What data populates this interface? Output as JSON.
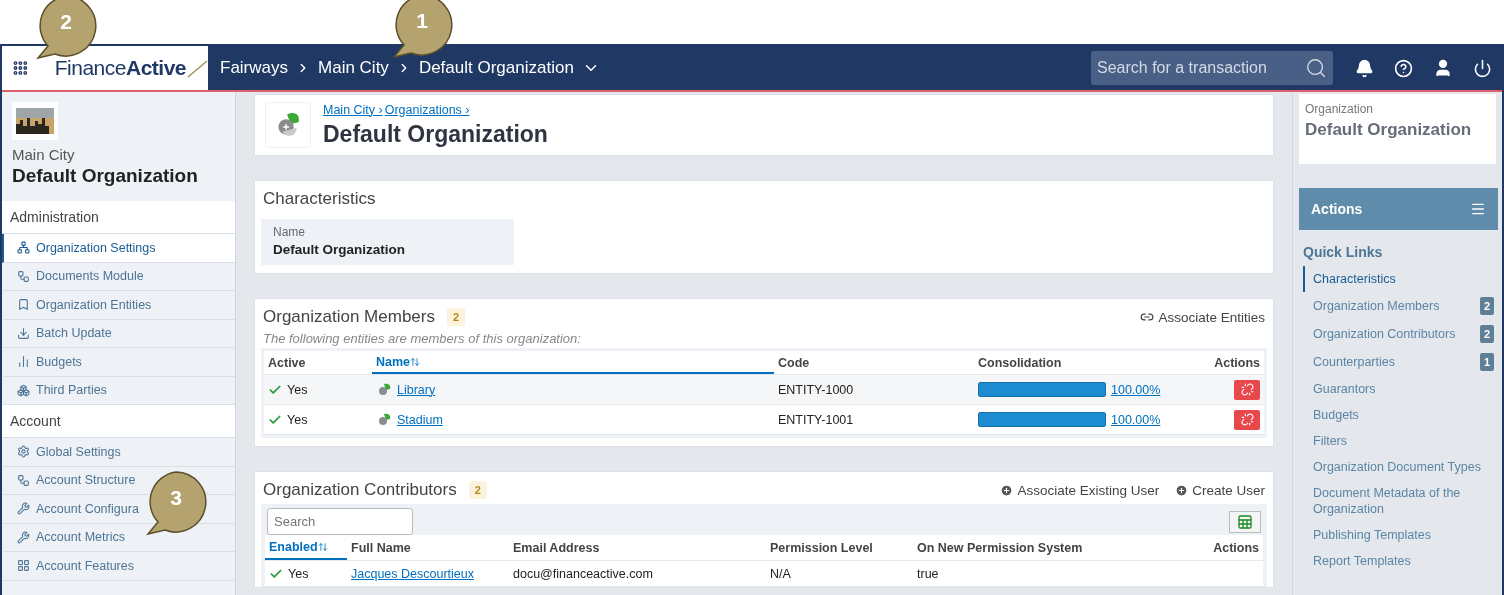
{
  "header": {
    "logo": {
      "first": "Finance",
      "second": "Active"
    },
    "breadcrumb": [
      "Fairways",
      "Main City",
      "Default Organization"
    ],
    "search": {
      "placeholder": "Search for a transaction"
    }
  },
  "callouts": [
    {
      "number": "1"
    },
    {
      "number": "2"
    },
    {
      "number": "3"
    }
  ],
  "sidebar": {
    "city": "Main City",
    "organization": "Default Organization",
    "sections": [
      {
        "title": "Administration",
        "items": [
          {
            "label": "Organization Settings",
            "selected": true
          },
          {
            "label": "Documents Module",
            "selected": false
          },
          {
            "label": "Organization Entities",
            "selected": false
          },
          {
            "label": "Batch Update",
            "selected": false
          },
          {
            "label": "Budgets",
            "selected": false
          },
          {
            "label": "Third Parties",
            "selected": false
          }
        ]
      },
      {
        "title": "Account",
        "items": [
          {
            "label": "Global Settings",
            "selected": false
          },
          {
            "label": "Account Structure",
            "selected": false
          },
          {
            "label": "Account Configura",
            "selected": false
          },
          {
            "label": "Account Metrics",
            "selected": false
          },
          {
            "label": "Account Features",
            "selected": false
          }
        ]
      }
    ]
  },
  "page": {
    "breadcrumb": [
      "Main City ›",
      "Organizations ›"
    ],
    "title": "Default Organization",
    "characteristics": {
      "title": "Characteristics",
      "field_label": "Name",
      "field_value": "Default Organization"
    },
    "members": {
      "title": "Organization Members",
      "count": "2",
      "action": "Associate Entities",
      "note": "The following entities are members of this organization:",
      "columns": [
        "Active",
        "Name",
        "Code",
        "Consolidation",
        "Actions"
      ],
      "rows": [
        {
          "active": "Yes",
          "name": "Library",
          "code": "ENTITY-1000",
          "level": 1.0,
          "percent": "100.00%"
        },
        {
          "active": "Yes",
          "name": "Stadium",
          "code": "ENTITY-1001",
          "level": 1.0,
          "percent": "100.00%"
        }
      ]
    },
    "contributors": {
      "title": "Organization Contributors",
      "count": "2",
      "actions": [
        "Associate Existing User",
        "Create User"
      ],
      "search": {
        "placeholder": "Search"
      },
      "columns": [
        "Enabled",
        "Full Name",
        "Email Address",
        "Permission Level",
        "On New Permission System",
        "Actions"
      ],
      "rows": [
        {
          "enabled": "Yes",
          "name": "Jacques Descourtieux",
          "email": "docu@financeactive.com",
          "permission": "N/A",
          "new_system": "true"
        }
      ]
    }
  },
  "right": {
    "label": "Organization",
    "value": "Default Organization",
    "actions_title": "Actions",
    "quick_links_title": "Quick Links",
    "links": [
      {
        "label": "Characteristics",
        "selected": true
      },
      {
        "label": "Organization Members",
        "count": "2",
        "selected": false
      },
      {
        "label": "Organization Contributors",
        "count": "2",
        "selected": false
      },
      {
        "label": "Counterparties",
        "count": "1",
        "selected": false
      },
      {
        "label": "Guarantors",
        "selected": false
      },
      {
        "label": "Budgets",
        "selected": false
      },
      {
        "label": "Filters",
        "selected": false
      },
      {
        "label": "Organization Document Types",
        "selected": false
      },
      {
        "label": "Document Metadata of the Organization",
        "selected": false
      },
      {
        "label": "Publishing Templates",
        "selected": false
      },
      {
        "label": "Report Templates",
        "selected": false
      }
    ]
  }
}
